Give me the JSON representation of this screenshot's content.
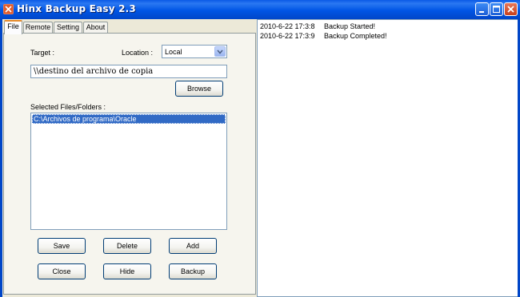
{
  "window": {
    "title": "Hinx Backup Easy 2.3",
    "app_icon": "hinx-logo-icon",
    "buttons": [
      "minimize-icon",
      "maximize-icon",
      "close-icon"
    ],
    "colors": {
      "titlebar": "#0055e5",
      "button_face": "#f4f4f0",
      "selection": "#316ac5",
      "active_tab_accent": "#e68b2c"
    }
  },
  "tabs": [
    {
      "label": "File",
      "active": true
    },
    {
      "label": "Remote",
      "active": false
    },
    {
      "label": "Setting",
      "active": false
    },
    {
      "label": "About",
      "active": false
    }
  ],
  "file_tab": {
    "target_label": "Target :",
    "location_label": "Location :",
    "location_value": "Local",
    "target_path": "\\\\destino del archivo de copia",
    "browse_label": "Browse",
    "selected_label": "Selected Files/Folders :",
    "selected_items": [
      "C:\\Archivos de programa\\Oracle"
    ],
    "buttons": {
      "save": "Save",
      "delete": "Delete",
      "add": "Add",
      "close": "Close",
      "hide": "Hide",
      "backup": "Backup"
    }
  },
  "log": [
    {
      "timestamp": "2010-6-22  17:3:8",
      "message": "Backup Started!"
    },
    {
      "timestamp": "2010-6-22  17:3:9",
      "message": "Backup Completed!"
    }
  ]
}
